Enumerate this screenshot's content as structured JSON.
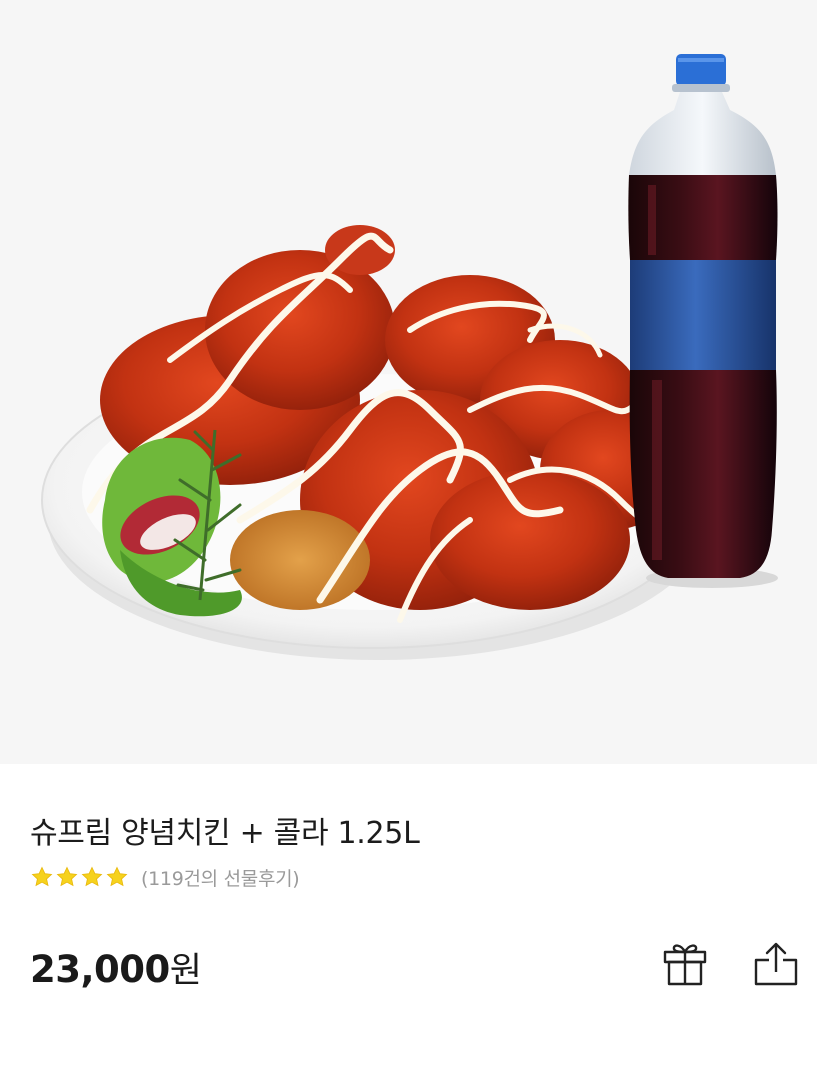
{
  "product": {
    "image_alt": "슈프림 양념치킨과 콜라 1.25L",
    "title": "슈프림 양념치킨 + 콜라 1.25L",
    "rating": 4,
    "rating_max": 5,
    "review_text": "(119건의 선물후기)",
    "price_amount": "23,000",
    "price_unit": "원"
  },
  "actions": [
    {
      "name": "gift-button",
      "icon": "gift-icon"
    },
    {
      "name": "share-button",
      "icon": "share-icon"
    }
  ],
  "colors": {
    "hero_bg": "#f6f6f6",
    "star": "#f6d21d",
    "review_text": "#9a9a9a",
    "icon": "#222222",
    "cola_label": "#2f5da8",
    "cola_cap": "#2b6fd6"
  }
}
